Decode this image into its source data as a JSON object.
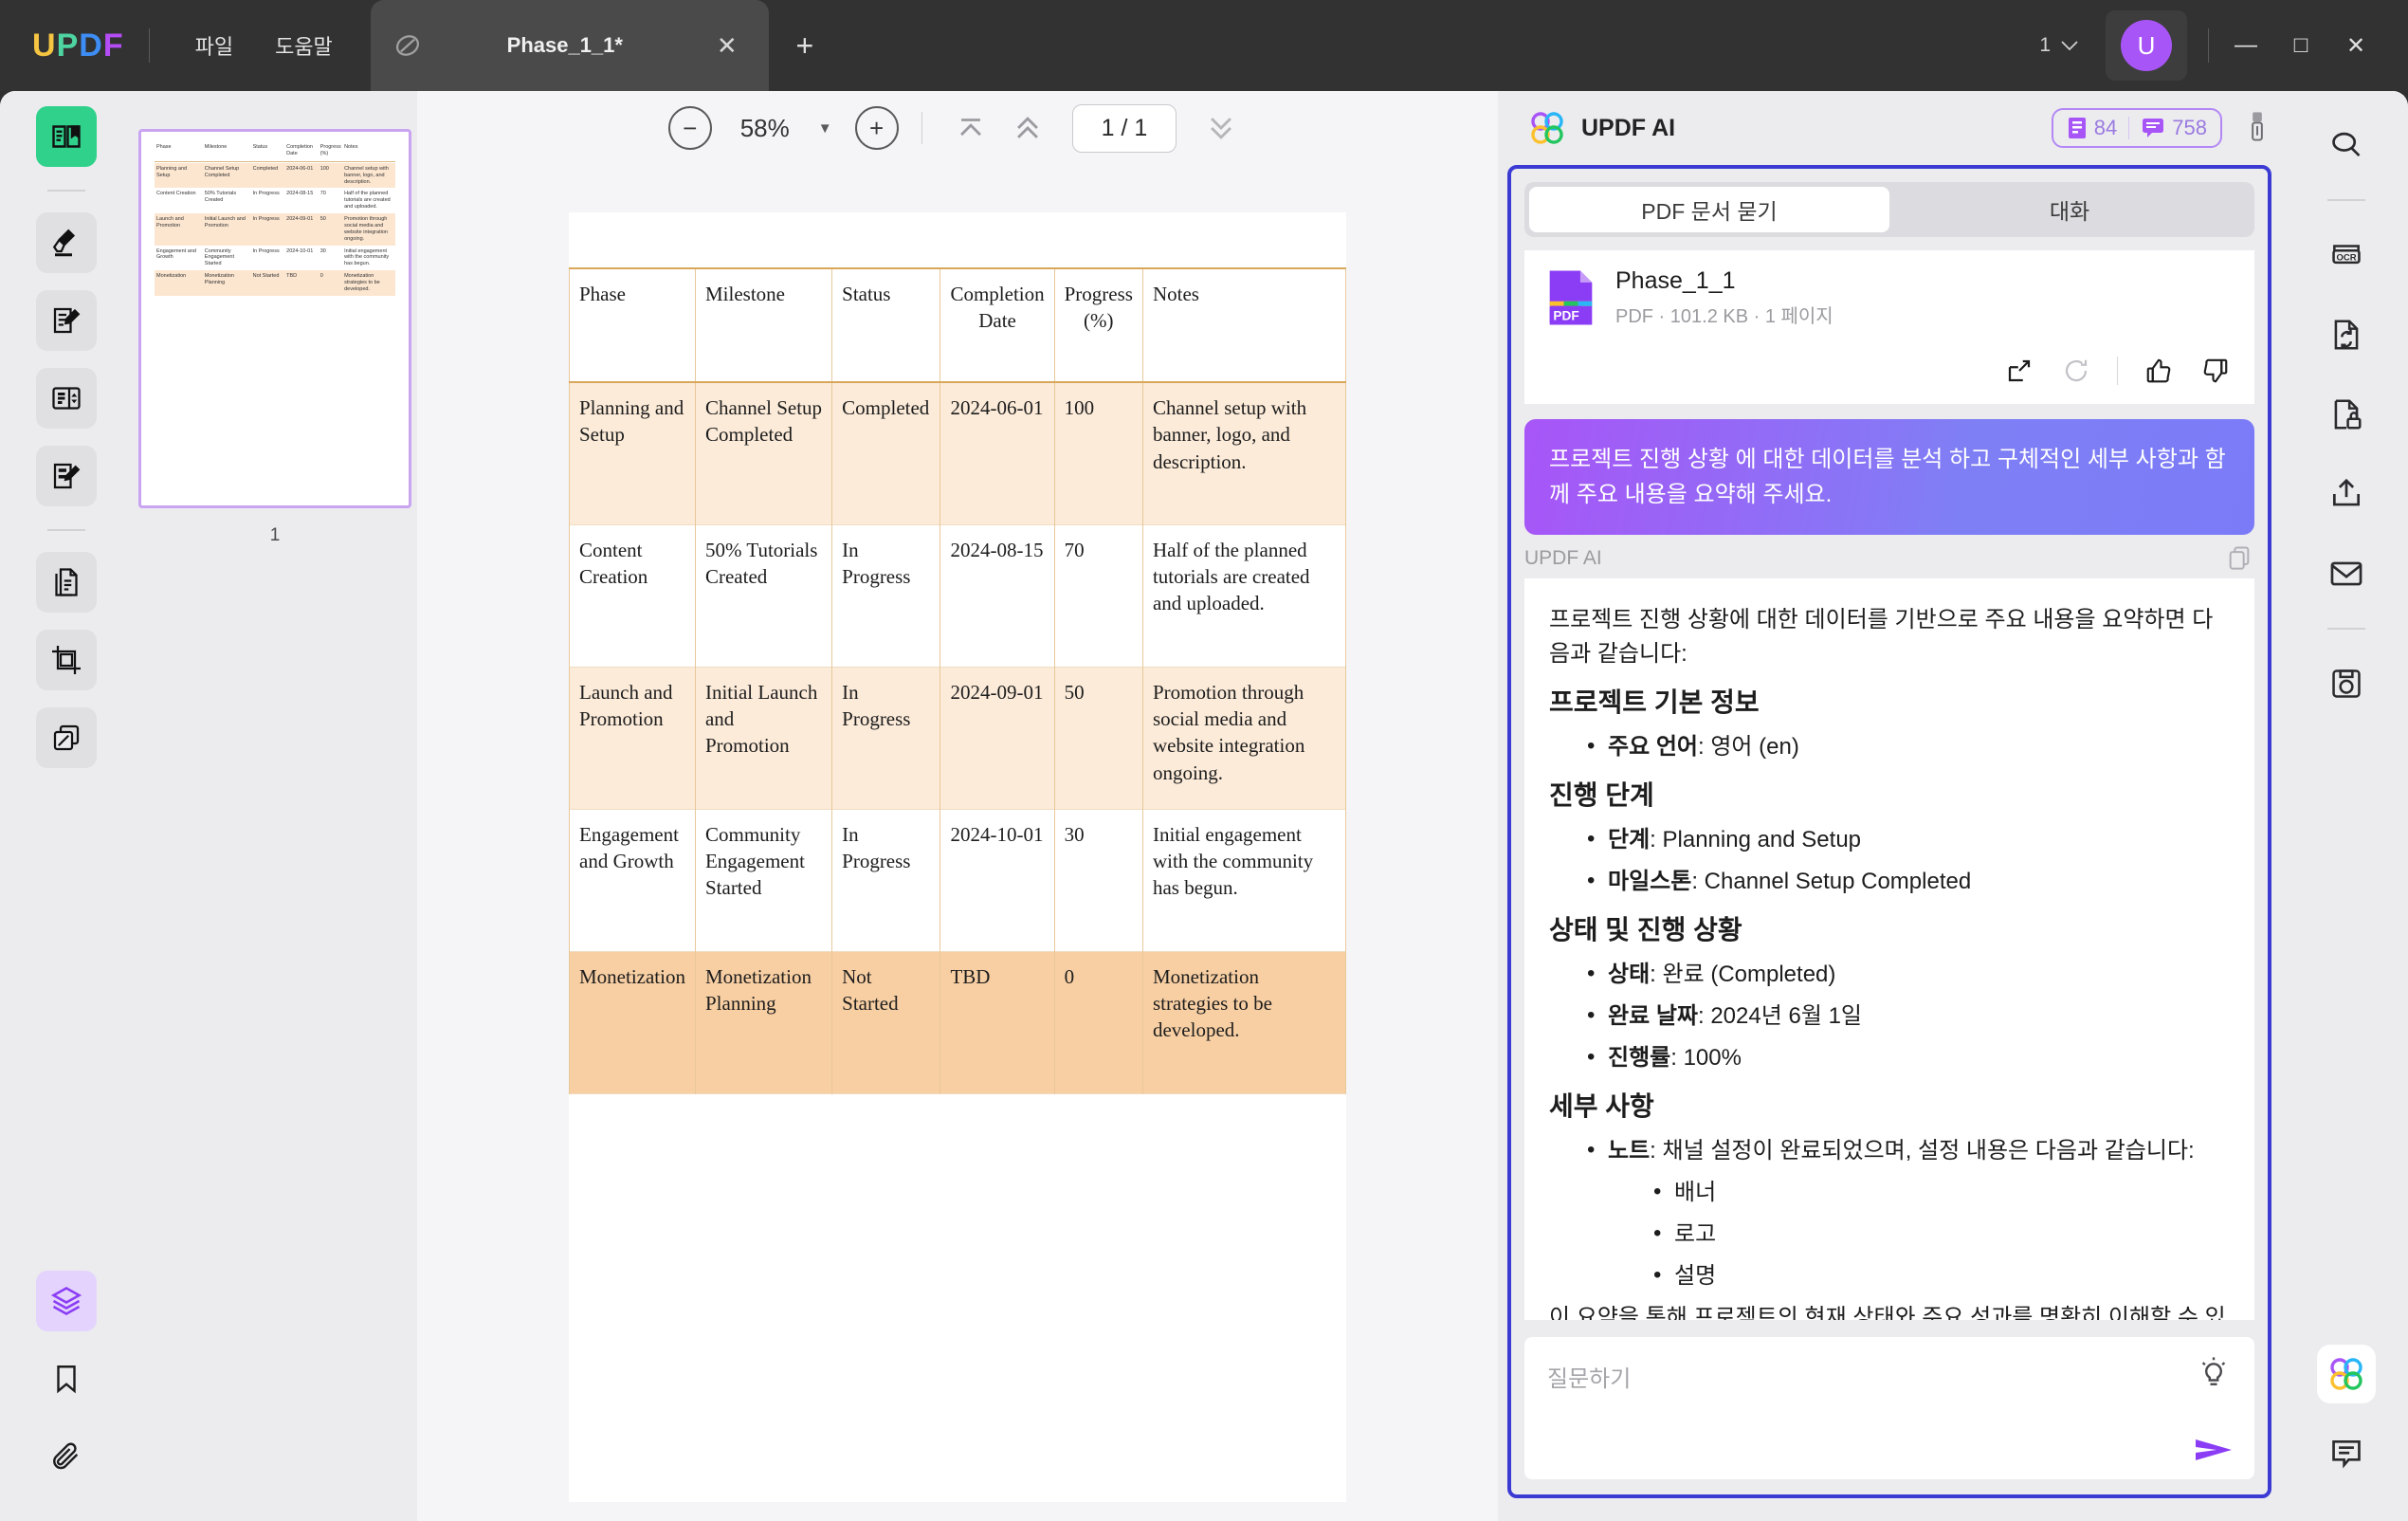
{
  "titlebar": {
    "logo": "UPDF",
    "logo_letters": [
      "U",
      "P",
      "D",
      "F"
    ],
    "menus": [
      {
        "label": "파일",
        "name": "menu-file"
      },
      {
        "label": "도움말",
        "name": "menu-help"
      }
    ],
    "tab": {
      "title": "Phase_1_1*",
      "close_label": "✕",
      "new_tab_label": "+"
    },
    "window_count": "1",
    "avatar_initial": "U",
    "window_controls": {
      "minimize": "—",
      "maximize": "□",
      "close": "✕"
    }
  },
  "left_rail": {
    "items": [
      {
        "name": "sidebar-item-reader",
        "icon": "book-reader-icon",
        "state": "active-green"
      },
      {
        "name": "sidebar-item-highlight",
        "icon": "highlighter-icon",
        "state": "idle"
      },
      {
        "name": "sidebar-item-edit-pdf",
        "icon": "document-pencil-icon",
        "state": "idle"
      },
      {
        "name": "sidebar-item-form",
        "icon": "form-fields-icon",
        "state": "idle"
      },
      {
        "name": "sidebar-item-sign",
        "icon": "signature-icon",
        "state": "idle"
      },
      {
        "name": "sidebar-item-organize",
        "icon": "pages-copy-icon",
        "state": "idle"
      },
      {
        "name": "sidebar-item-crop",
        "icon": "crop-icon",
        "state": "idle"
      },
      {
        "name": "sidebar-item-batch",
        "icon": "stack-pages-icon",
        "state": "idle"
      }
    ],
    "bottom_items": [
      {
        "name": "sidebar-item-layers",
        "icon": "layers-icon",
        "state": "active-purple"
      },
      {
        "name": "sidebar-item-bookmark",
        "icon": "bookmark-icon",
        "state": "plain"
      },
      {
        "name": "sidebar-item-attachment",
        "icon": "paperclip-icon",
        "state": "plain"
      }
    ]
  },
  "thumbnails": {
    "page_number": "1"
  },
  "viewer_toolbar": {
    "zoom_out": "−",
    "zoom_value": "58%",
    "zoom_in": "+",
    "page_indicator": "1 / 1",
    "first_page_icon": "first-page-icon",
    "prev_page_icon": "prev-page-icon",
    "next_page_icon": "next-page-icon"
  },
  "pdf_table": {
    "headers": [
      "Phase",
      "Milestone",
      "Status",
      "Completion Date",
      "Progress (%)",
      "Notes"
    ],
    "headers_split": [
      [
        "Phase"
      ],
      [
        "Milestone"
      ],
      [
        "Status"
      ],
      [
        "Completion",
        "Date"
      ],
      [
        "Progress",
        "(%)"
      ],
      [
        "Notes"
      ]
    ],
    "rows": [
      {
        "phase": "Planning and Setup",
        "milestone": "Channel Setup Completed",
        "status": "Completed",
        "completion_date": "2024-06-01",
        "progress": "100",
        "notes": "Channel setup with banner, logo, and description.",
        "highlight": "light"
      },
      {
        "phase": "Content Creation",
        "milestone": "50% Tutorials Created",
        "status": "In Progress",
        "completion_date": "2024-08-15",
        "progress": "70",
        "notes": "Half of the planned tutorials are created and uploaded.",
        "highlight": "none"
      },
      {
        "phase": "Launch and Promotion",
        "milestone": "Initial Launch and Promotion",
        "status": "In Progress",
        "completion_date": "2024-09-01",
        "progress": "50",
        "notes": "Promotion through social media and website integration ongoing.",
        "highlight": "light"
      },
      {
        "phase": "Engagement and Growth",
        "milestone": "Community Engagement Started",
        "status": "In Progress",
        "completion_date": "2024-10-01",
        "progress": "30",
        "notes": "Initial engagement with the community has begun.",
        "highlight": "none"
      },
      {
        "phase": "Monetization",
        "milestone": "Monetization Planning",
        "status": "Not Started",
        "completion_date": "TBD",
        "progress": "0",
        "notes": "Monetization strategies to be developed.",
        "highlight": "dark"
      }
    ]
  },
  "ai_panel": {
    "title": "UPDF AI",
    "credits": {
      "pages": "84",
      "messages": "758"
    },
    "brush_icon": "brush-icon",
    "tabs": [
      {
        "label": "PDF 문서 묻기",
        "name": "tab-ask-pdf",
        "active": true
      },
      {
        "label": "대화",
        "name": "tab-chat",
        "active": false
      }
    ],
    "file": {
      "name": "Phase_1_1",
      "meta": "PDF · 101.2 KB · 1 페이지",
      "badge": "PDF"
    },
    "actions": [
      {
        "name": "open-external-icon"
      },
      {
        "name": "refresh-icon"
      },
      {
        "name": "thumbs-up-icon"
      },
      {
        "name": "thumbs-down-icon"
      }
    ],
    "user_message": "프로젝트 진행 상황 에 대한 데이터를 분석 하고 구체적인 세부 사항과 함께 주요 내용을 요약해 주세요.",
    "ai_label": "UPDF AI",
    "answer": {
      "intro": "프로젝트 진행 상황에 대한 데이터를 기반으로 주요 내용을 요약하면 다음과 같습니다:",
      "sections": [
        {
          "heading": "프로젝트 기본 정보",
          "items": [
            {
              "label": "주요 언어",
              "value": ": 영어 (en)"
            }
          ]
        },
        {
          "heading": "진행 단계",
          "items": [
            {
              "label": "단계",
              "value": ": Planning and Setup"
            },
            {
              "label": "마일스톤",
              "value": ": Channel Setup Completed"
            }
          ]
        },
        {
          "heading": "상태 및 진행 상황",
          "items": [
            {
              "label": "상태",
              "value": ": 완료 (Completed)"
            },
            {
              "label": "완료 날짜",
              "value": ": 2024년 6월 1일"
            },
            {
              "label": "진행률",
              "value": ": 100%"
            }
          ]
        },
        {
          "heading": "세부 사항",
          "items": [
            {
              "label": "노트",
              "value": ": 채널 설정이 완료되었으며, 설정 내용은 다음과 같습니다:"
            }
          ],
          "subitems": [
            "배너",
            "로고",
            "설명"
          ]
        }
      ],
      "outro": "이 요약을 통해 프로젝트의 현재 상태와 주요 성과를 명확히 이해할 수 있습니다."
    },
    "ask_placeholder": "질문하기",
    "bulb_icon": "lightbulb-icon",
    "send_icon": "send-icon"
  },
  "right_rail": {
    "items": [
      {
        "name": "search-icon"
      },
      {
        "name": "ocr-icon"
      },
      {
        "name": "convert-icon"
      },
      {
        "name": "protect-icon"
      },
      {
        "name": "share-icon"
      },
      {
        "name": "email-icon"
      },
      {
        "name": "save-icon"
      }
    ],
    "bottom_items": [
      {
        "name": "updf-ai-icon"
      },
      {
        "name": "comment-icon"
      }
    ]
  },
  "colors": {
    "accent_purple": "#a855f7",
    "ai_border": "#3b3bd4",
    "active_green": "#2fd18b",
    "table_highlight_light": "#fcebd9",
    "table_highlight_dark": "#f8cfa3"
  }
}
